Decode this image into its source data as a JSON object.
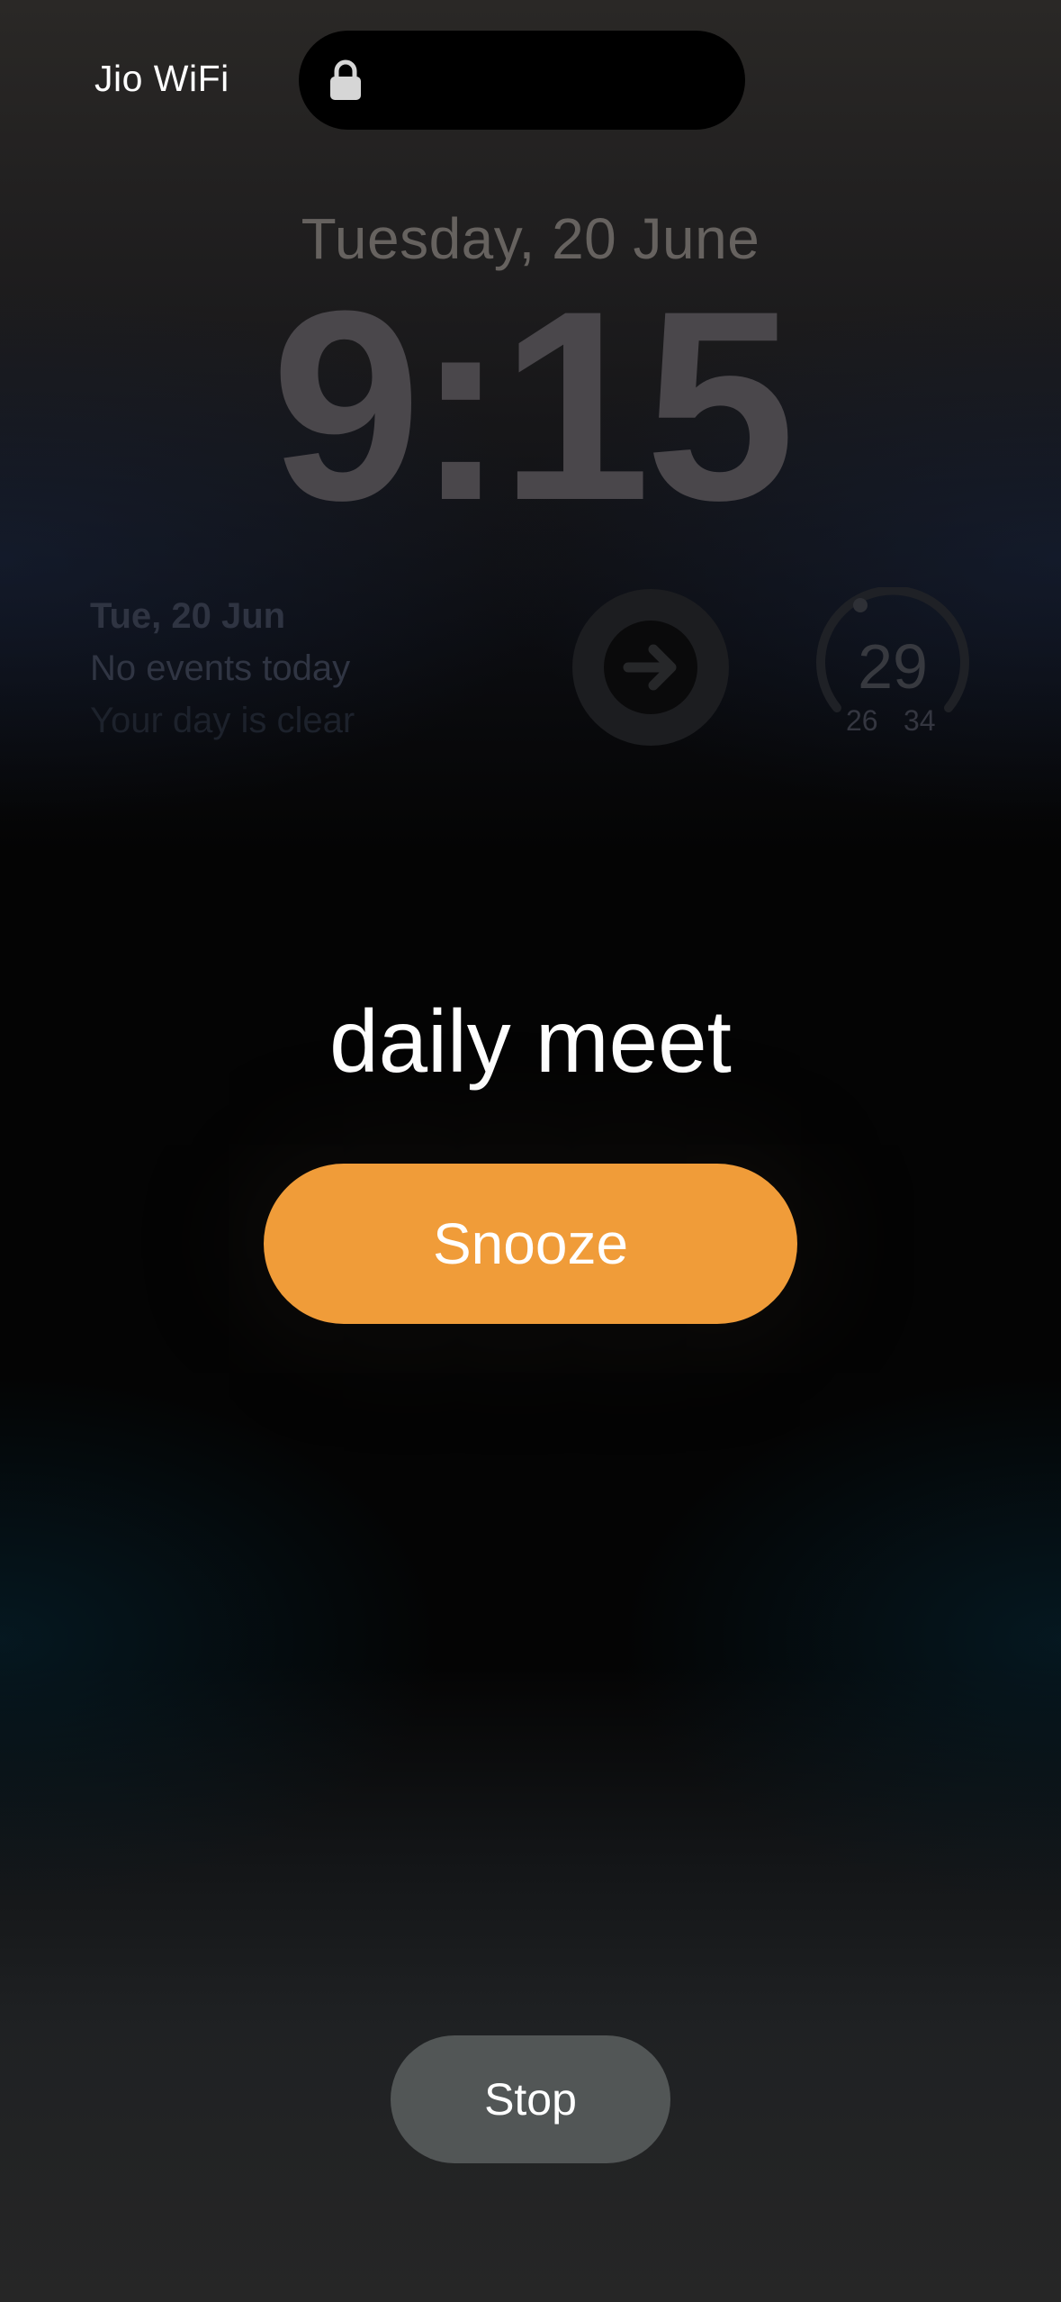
{
  "status_bar": {
    "carrier": "Jio WiFi",
    "lock_icon": "lock-icon"
  },
  "lock_screen": {
    "date": "Tuesday, 20 June",
    "time": "9:15",
    "calendar_widget": {
      "date": "Tue, 20 Jun",
      "events": "No events today",
      "subtitle": "Your day is clear"
    },
    "shortcut_widget": {
      "icon": "arrow-right-icon"
    },
    "weather_widget": {
      "current": "29",
      "low": "26",
      "high": "34"
    }
  },
  "alarm": {
    "label": "daily meet",
    "snooze_label": "Snooze",
    "stop_label": "Stop"
  },
  "colors": {
    "snooze": "#f09c39",
    "stop": "#525656",
    "background": "#050505"
  }
}
